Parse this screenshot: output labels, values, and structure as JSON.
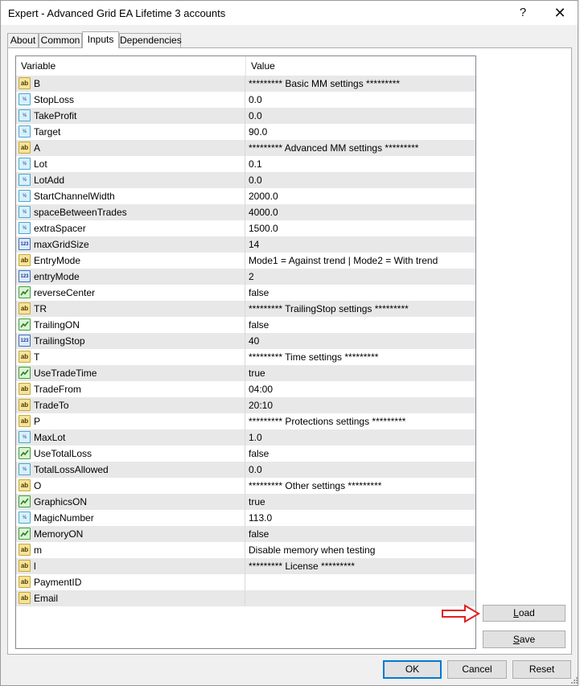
{
  "window": {
    "title": "Expert - Advanced Grid EA Lifetime 3 accounts",
    "help_label": "?",
    "close_label": "✕"
  },
  "tabs": [
    {
      "label": "About"
    },
    {
      "label": "Common"
    },
    {
      "label": "Inputs"
    },
    {
      "label": "Dependencies"
    }
  ],
  "active_tab": "Inputs",
  "grid": {
    "columns": {
      "variable": "Variable",
      "value": "Value"
    },
    "rows": [
      {
        "icon": "ab",
        "name": "B",
        "value": "********* Basic MM settings *********"
      },
      {
        "icon": "half",
        "name": "StopLoss",
        "value": "0.0"
      },
      {
        "icon": "half",
        "name": "TakeProfit",
        "value": "0.0"
      },
      {
        "icon": "half",
        "name": "Target",
        "value": "90.0"
      },
      {
        "icon": "ab",
        "name": "A",
        "value": "********* Advanced MM settings *********"
      },
      {
        "icon": "half",
        "name": "Lot",
        "value": "0.1"
      },
      {
        "icon": "half",
        "name": "LotAdd",
        "value": "0.0"
      },
      {
        "icon": "half",
        "name": "StartChannelWidth",
        "value": "2000.0"
      },
      {
        "icon": "half",
        "name": "spaceBetweenTrades",
        "value": "4000.0"
      },
      {
        "icon": "half",
        "name": "extraSpacer",
        "value": "1500.0"
      },
      {
        "icon": "n123",
        "name": "maxGridSize",
        "value": "14"
      },
      {
        "icon": "ab",
        "name": "EntryMode",
        "value": "Mode1 = Against trend | Mode2 = With trend"
      },
      {
        "icon": "n123",
        "name": "entryMode",
        "value": "2"
      },
      {
        "icon": "bool",
        "name": "reverseCenter",
        "value": "false"
      },
      {
        "icon": "ab",
        "name": "TR",
        "value": "********* TrailingStop settings *********"
      },
      {
        "icon": "bool",
        "name": "TrailingON",
        "value": "false"
      },
      {
        "icon": "n123",
        "name": "TrailingStop",
        "value": "40"
      },
      {
        "icon": "ab",
        "name": "T",
        "value": "********* Time settings *********"
      },
      {
        "icon": "bool",
        "name": "UseTradeTime",
        "value": "true"
      },
      {
        "icon": "ab",
        "name": "TradeFrom",
        "value": "04:00"
      },
      {
        "icon": "ab",
        "name": "TradeTo",
        "value": "20:10"
      },
      {
        "icon": "ab",
        "name": "P",
        "value": "********* Protections settings *********"
      },
      {
        "icon": "half",
        "name": "MaxLot",
        "value": "1.0"
      },
      {
        "icon": "bool",
        "name": "UseTotalLoss",
        "value": "false"
      },
      {
        "icon": "half",
        "name": "TotalLossAllowed",
        "value": "0.0"
      },
      {
        "icon": "ab",
        "name": "O",
        "value": "********* Other settings *********"
      },
      {
        "icon": "bool",
        "name": "GraphicsON",
        "value": "true"
      },
      {
        "icon": "half",
        "name": "MagicNumber",
        "value": "113.0"
      },
      {
        "icon": "bool",
        "name": "MemoryON",
        "value": "false"
      },
      {
        "icon": "ab",
        "name": "m",
        "value": "Disable memory when testing"
      },
      {
        "icon": "ab",
        "name": "l",
        "value": "********* License *********"
      },
      {
        "icon": "ab",
        "name": "PaymentID",
        "value": ""
      },
      {
        "icon": "ab",
        "name": "Email",
        "value": ""
      }
    ]
  },
  "side_buttons": {
    "load": {
      "label_u": "L",
      "label_rest": "oad"
    },
    "save": {
      "label_u": "S",
      "label_rest": "ave"
    }
  },
  "annotation": {
    "arrow_color": "#e02020",
    "points_to": "load-button"
  },
  "footer": {
    "ok": "OK",
    "cancel": "Cancel",
    "reset": "Reset"
  }
}
